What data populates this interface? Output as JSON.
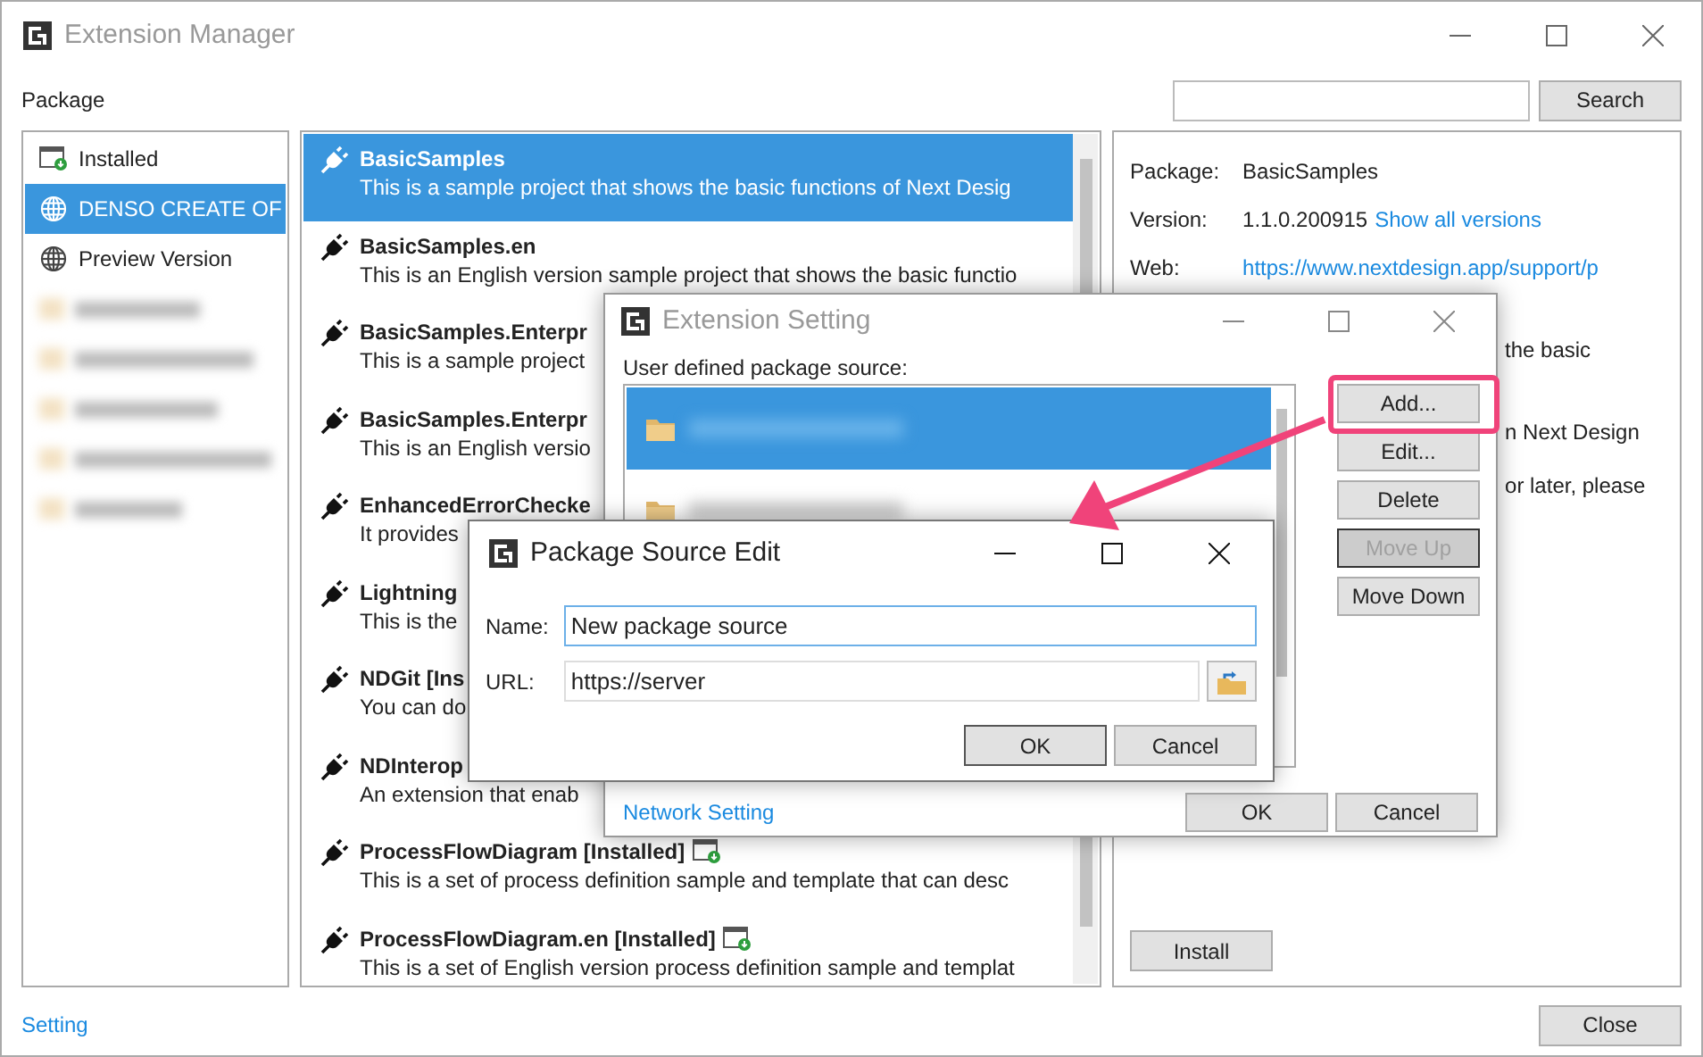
{
  "window": {
    "title": "Extension Manager"
  },
  "package_label": "Package",
  "search": {
    "button": "Search"
  },
  "sidebar": {
    "items": [
      {
        "label": "Installed",
        "kind": "installed",
        "selected": false
      },
      {
        "label": "DENSO CREATE OF",
        "kind": "source",
        "selected": true
      },
      {
        "label": "Preview Version",
        "kind": "source",
        "selected": false
      }
    ]
  },
  "packages": [
    {
      "name": "BasicSamples",
      "description": "This is a sample project that shows the basic functions of Next Desig",
      "installed": false,
      "selected": true
    },
    {
      "name": "BasicSamples.en",
      "description": "This is an English version sample project that shows the basic functio",
      "installed": false,
      "selected": false
    },
    {
      "name": "BasicSamples.Enterpr",
      "description": "This is a sample project",
      "installed": false,
      "selected": false
    },
    {
      "name": "BasicSamples.Enterpr",
      "description": "This is an English versio",
      "installed": false,
      "selected": false
    },
    {
      "name": "EnhancedErrorChecke",
      "description": "It provides",
      "installed": false,
      "selected": false
    },
    {
      "name": "Lightning",
      "description": "This is the",
      "installed": false,
      "selected": false
    },
    {
      "name": "NDGit [Ins",
      "description": "You can do",
      "installed": false,
      "selected": false
    },
    {
      "name": "NDInterop",
      "description": "An extension that enab",
      "installed": false,
      "selected": false
    },
    {
      "name": "ProcessFlowDiagram [Installed]",
      "description": "This is a set of process definition sample and template that can desc",
      "installed": true,
      "selected": false
    },
    {
      "name": "ProcessFlowDiagram.en [Installed]",
      "description": "This is a set of English version process definition sample and templat",
      "installed": true,
      "selected": false
    }
  ],
  "details": {
    "rows": [
      {
        "label": "Package:",
        "value": "BasicSamples"
      },
      {
        "label": "Version:",
        "value": "1.1.0.200915",
        "link": "Show all versions"
      },
      {
        "label": "Web:",
        "link": "https://www.nextdesign.app/support/p"
      }
    ],
    "description_fragments": [
      "the basic",
      "n Next Design",
      "or later, please"
    ],
    "install_button": "Install"
  },
  "setting_link": "Setting",
  "close_button": "Close",
  "extension_setting": {
    "title": "Extension Setting",
    "list_label": "User defined package source:",
    "sources": [
      {
        "selected": true
      },
      {
        "selected": false
      }
    ],
    "buttons": [
      {
        "label": "Add...",
        "disabled": false,
        "highlighted": true
      },
      {
        "label": "Edit...",
        "disabled": false,
        "highlighted": false
      },
      {
        "label": "Delete",
        "disabled": false,
        "highlighted": false
      },
      {
        "label": "Move Up",
        "disabled": true,
        "highlighted": false
      },
      {
        "label": "Move Down",
        "disabled": false,
        "highlighted": false
      }
    ],
    "network_link": "Network Setting",
    "ok": "OK",
    "cancel": "Cancel"
  },
  "source_edit": {
    "title": "Package Source Edit",
    "name_label": "Name:",
    "name_value": "New package source",
    "url_label": "URL:",
    "url_value": "https://server",
    "ok": "OK",
    "cancel": "Cancel"
  }
}
